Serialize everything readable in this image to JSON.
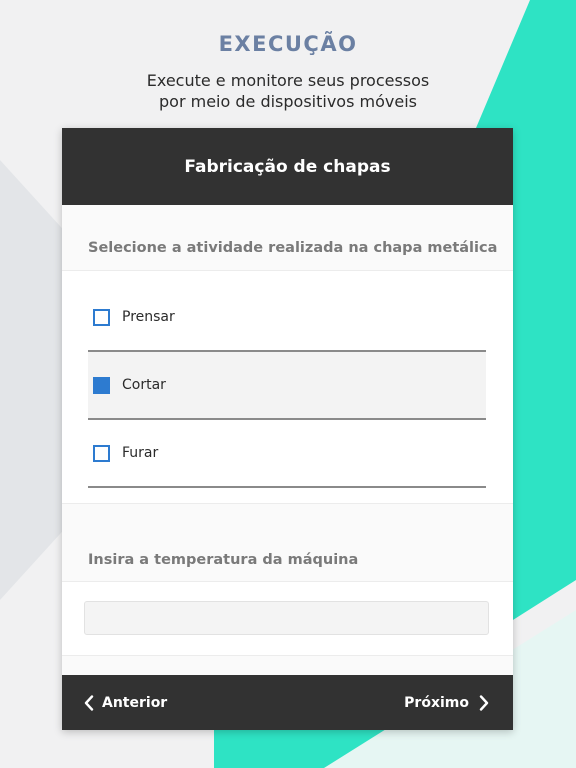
{
  "colors": {
    "background": "#f1f1f2",
    "accent_teal": "#2ee3c4",
    "background_gray_shape": "#e3e5e8",
    "title_blue": "#6b80a3",
    "header_dark": "#323232",
    "checkbox_blue": "#2d7bd0"
  },
  "hero": {
    "title": "EXECUÇÃO",
    "subtitle_line1": "Execute e monitore seus processos",
    "subtitle_line2": "por meio de dispositivos móveis"
  },
  "card": {
    "header_title": "Fabricação de chapas",
    "question_activity": "Selecione a atividade realizada na chapa metálica",
    "options": [
      {
        "label": "Prensar",
        "checked": false
      },
      {
        "label": "Cortar",
        "checked": true
      },
      {
        "label": "Furar",
        "checked": false
      }
    ],
    "question_temperature": "Insira a temperatura da máquina",
    "temperature_value": "",
    "footer": {
      "prev_label": "Anterior",
      "next_label": "Próximo",
      "prev_icon": "chevron-left-icon",
      "next_icon": "chevron-right-icon"
    }
  }
}
